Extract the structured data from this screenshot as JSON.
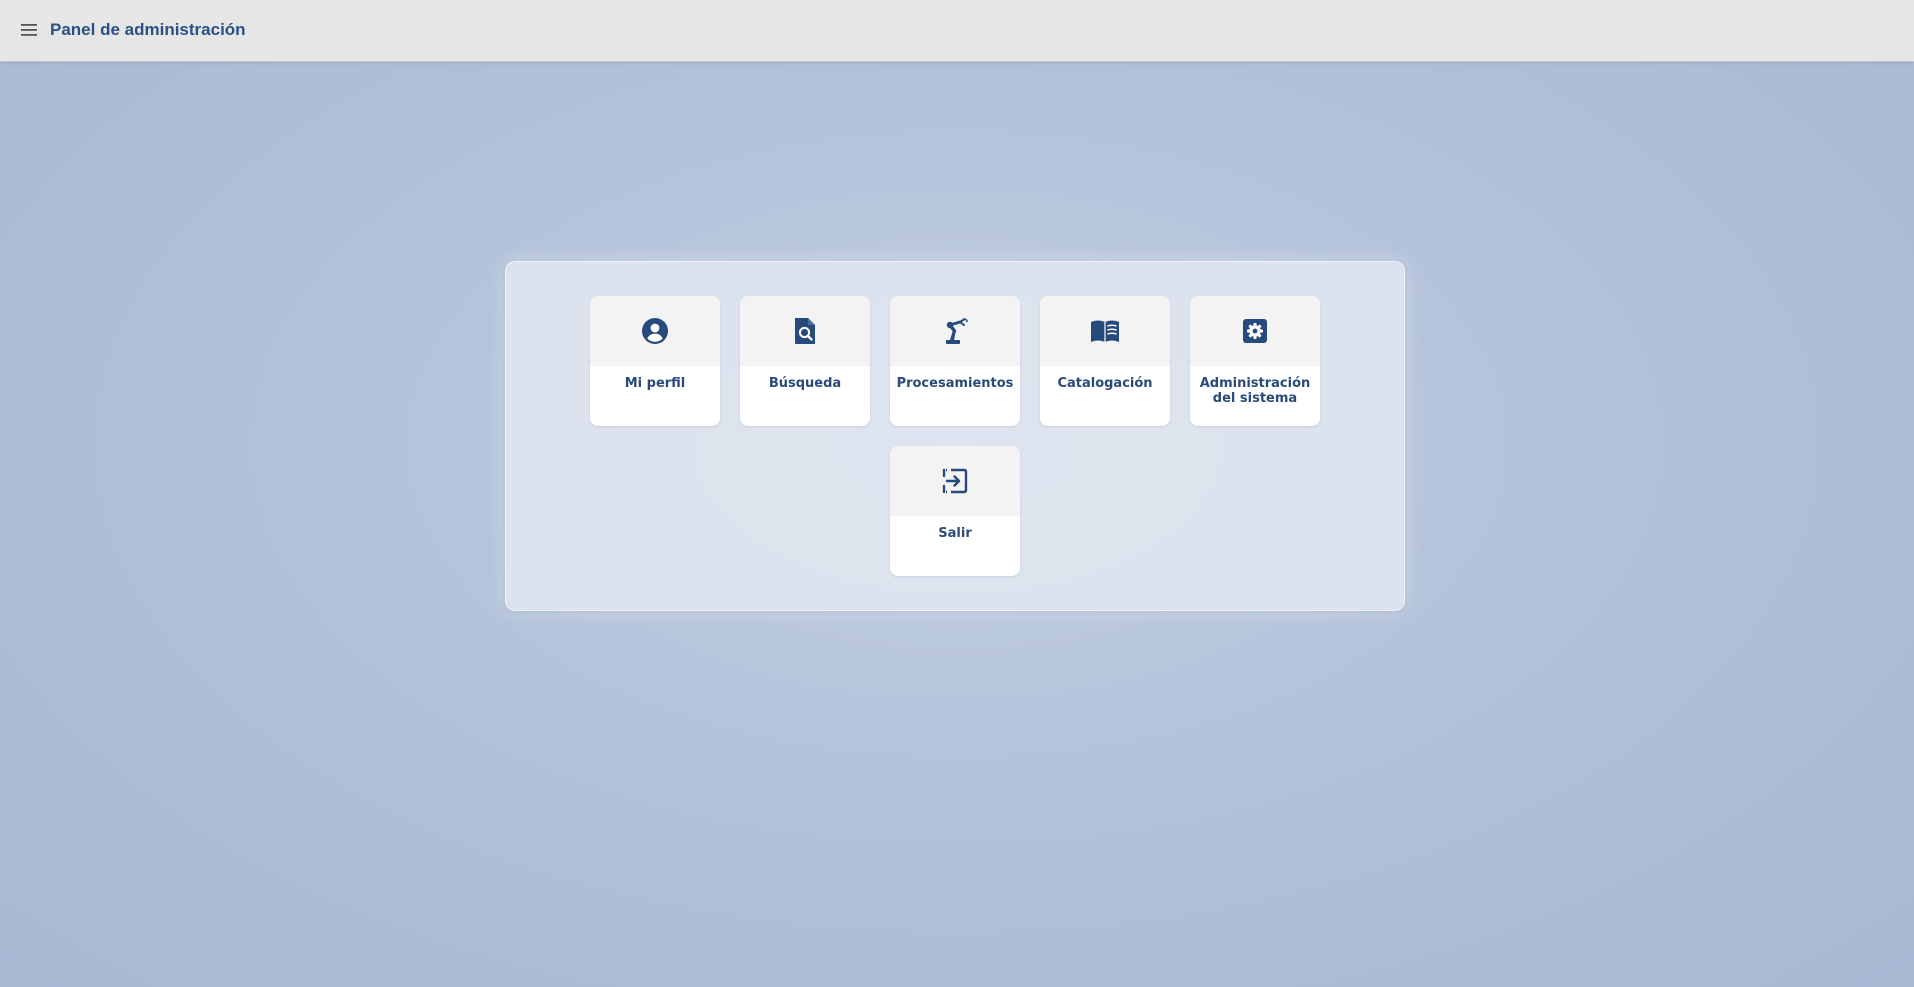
{
  "header": {
    "title": "Panel de administración",
    "menu_icon": "hamburger-menu-icon"
  },
  "colors": {
    "accent": "#2a5185",
    "topbar": "#e6e6e6",
    "background": "#b3c2da",
    "icon": "#264a7c"
  },
  "tiles": [
    {
      "label": "Mi perfil",
      "icon": "user-circle-icon"
    },
    {
      "label": "Búsqueda",
      "icon": "document-search-icon"
    },
    {
      "label": "Procesamientos",
      "icon": "robotic-arm-icon"
    },
    {
      "label": "Catalogación",
      "icon": "open-book-icon"
    },
    {
      "label": "Administración del sistema",
      "icon": "settings-gear-icon"
    },
    {
      "label": "Salir",
      "icon": "exit-icon"
    }
  ]
}
